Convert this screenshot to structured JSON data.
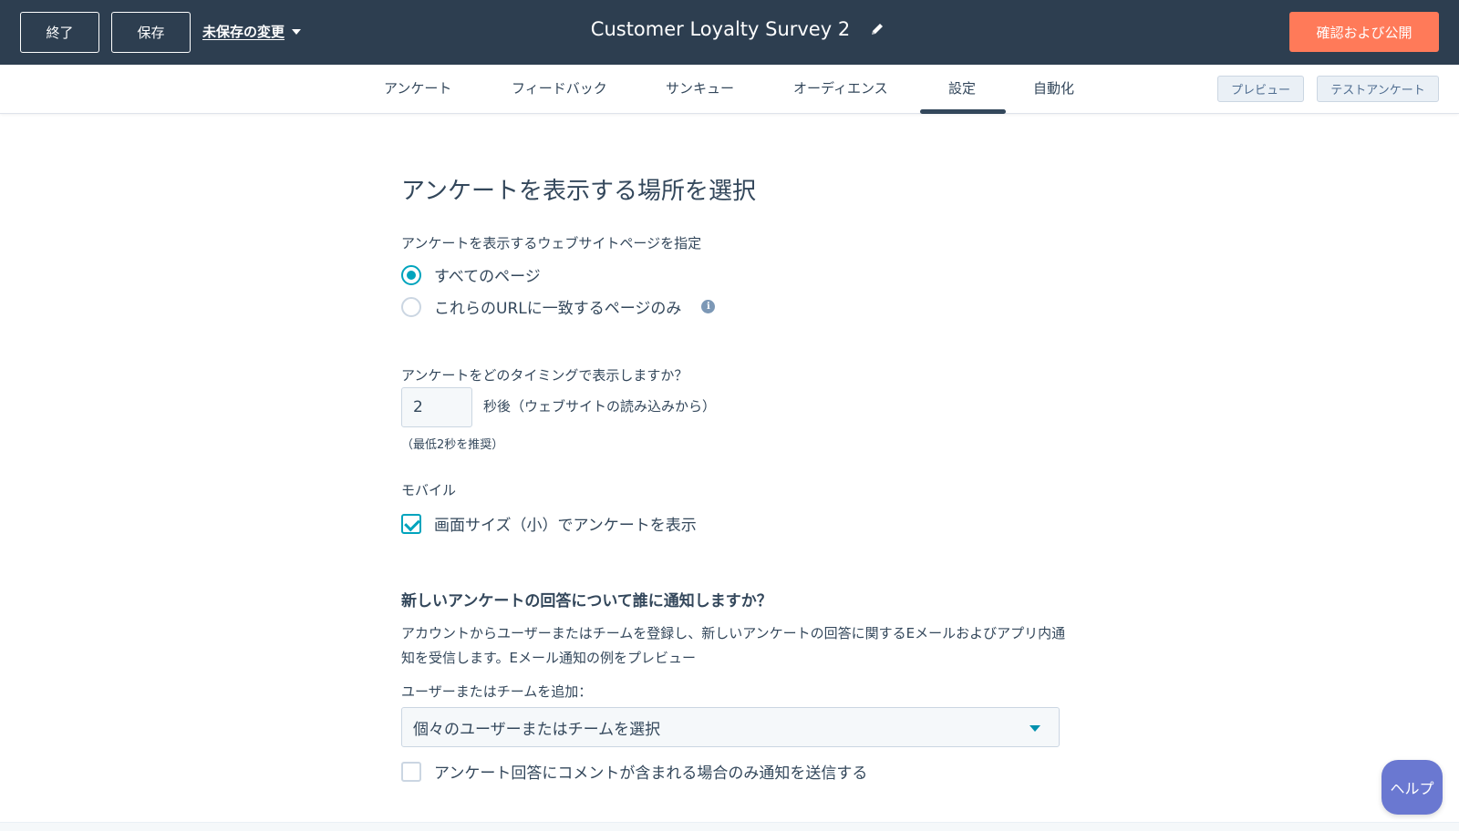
{
  "header": {
    "exit_label": "終了",
    "save_label": "保存",
    "unsaved_label": "未保存の変更",
    "survey_title": "Customer Loyalty Survey 2",
    "publish_label": "確認および公開"
  },
  "tabs": [
    {
      "label": "アンケート"
    },
    {
      "label": "フィードバック"
    },
    {
      "label": "サンキュー"
    },
    {
      "label": "オーディエンス"
    },
    {
      "label": "設定",
      "active": true
    },
    {
      "label": "自動化"
    }
  ],
  "toolbar": {
    "preview_label": "プレビュー",
    "test_label": "テストアンケート"
  },
  "settings": {
    "heading": "アンケートを表示する場所を選択",
    "pages_label": "アンケートを表示するウェブサイトページを指定",
    "option_all": "すべてのページ",
    "option_url": "これらのURLに一致するページのみ",
    "info_glyph": "i",
    "timing_label": "アンケートをどのタイミングで表示しますか？",
    "timing_value": "2",
    "timing_suffix": "秒後（ウェブサイトの読み込みから）",
    "timing_hint": "（最低2秒を推奨）",
    "mobile_label": "モバイル",
    "mobile_option": "画面サイズ（小）でアンケートを表示",
    "notify_heading": "新しいアンケートの回答について誰に通知しますか？",
    "notify_desc": "アカウントからユーザーまたはチームを登録し、新しいアンケートの回答に関するEメールおよびアプリ内通知を受信します。Eメール通知の例をプレビュー",
    "add_label": "ユーザーまたはチームを追加：",
    "select_placeholder": "個々のユーザーまたはチームを選択",
    "comment_only_label": "アンケート回答にコメントが含まれる場合のみ通知を送信する"
  },
  "help_label": "ヘルプ",
  "colors": {
    "header_bg": "#2d3e50",
    "accent_orange": "#ff7a59",
    "accent_teal": "#00a4bd",
    "help_purple": "#6a78d1"
  }
}
